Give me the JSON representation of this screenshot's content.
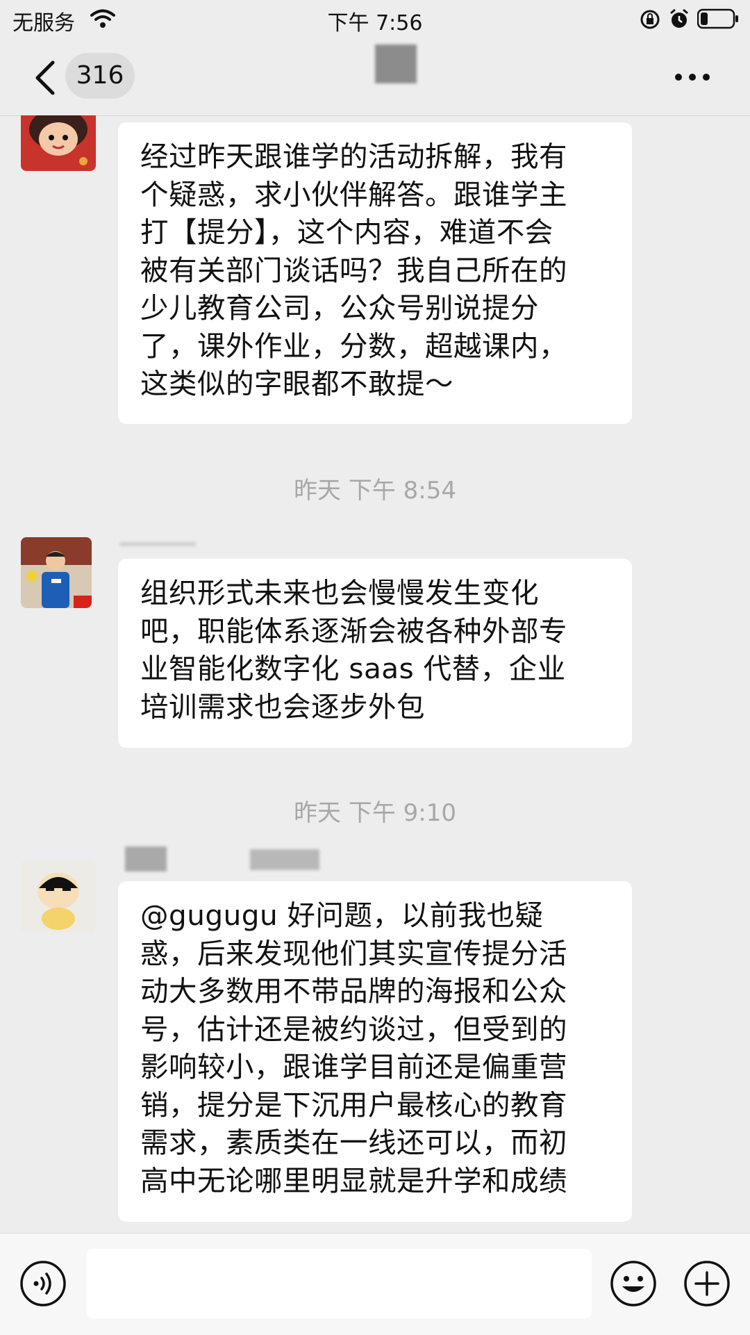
{
  "status_bar": {
    "carrier": "无服务",
    "time": "下午 7:56",
    "icons": [
      "wifi-icon",
      "orientation-lock-icon",
      "alarm-icon",
      "battery-icon"
    ]
  },
  "nav": {
    "back_icon": "back-chevron-icon",
    "unread_count": "316",
    "title": "",
    "more_icon": "more-icon"
  },
  "messages": [
    {
      "text": "经过昨天跟谁学的活动拆解，我有\n个疑惑，求小伙伴解答。跟谁学主\n打【提分】，这个内容，难道不会\n被有关部门谈话吗？我自己所在的\n少儿教育公司，公众号别说提分\n了，课外作业，分数，超越课内，\n这类似的字眼都不敢提～"
    },
    {
      "timestamp": "昨天 下午 8:54"
    },
    {
      "text": "组织形式未来也会慢慢发生变化\n吧，职能体系逐渐会被各种外部专\n业智能化数字化 saas 代替，企业\n培训需求也会逐步外包"
    },
    {
      "timestamp": "昨天 下午 9:10"
    },
    {
      "text": "@gugugu 好问题，以前我也疑\n惑，后来发现他们其实宣传提分活\n动大多数用不带品牌的海报和公众\n号，估计还是被约谈过，但受到的\n影响较小，跟谁学目前还是偏重营\n销，提分是下沉用户最核心的教育\n需求，素质类在一线还可以，而初\n高中无论哪里明显就是升学和成绩"
    }
  ],
  "input_bar": {
    "voice_icon": "voice-icon",
    "input_value": "",
    "emoji_icon": "emoji-icon",
    "plus_icon": "plus-icon"
  },
  "colors": {
    "background": "#ededed",
    "bubble": "#ffffff",
    "timestamp": "#a7a7a7"
  }
}
